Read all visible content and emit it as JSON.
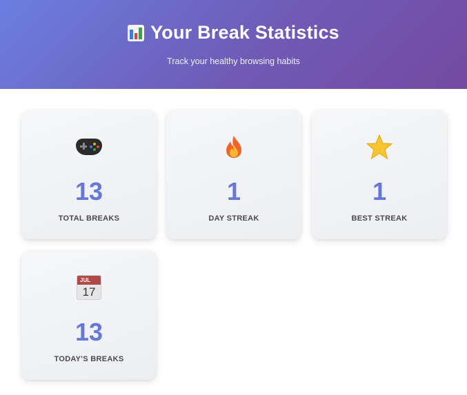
{
  "header": {
    "title": "Your Break Statistics",
    "subtitle": "Track your healthy browsing habits",
    "title_icon": "bar-chart-icon",
    "gradient_start": "#6a7fe0",
    "gradient_end": "#7549a0"
  },
  "stats": [
    {
      "icon": "gamepad-icon",
      "value": "13",
      "label": "TOTAL BREAKS"
    },
    {
      "icon": "fire-icon",
      "value": "1",
      "label": "DAY STREAK"
    },
    {
      "icon": "star-icon",
      "value": "1",
      "label": "BEST STREAK"
    },
    {
      "icon": "calendar-icon",
      "value": "13",
      "label": "TODAY'S BREAKS",
      "calendar_month": "JUL",
      "calendar_day": "17"
    }
  ],
  "colors": {
    "accent": "#6677d8",
    "label": "#4a4a4a",
    "card_bg": "#f2f3f6"
  }
}
